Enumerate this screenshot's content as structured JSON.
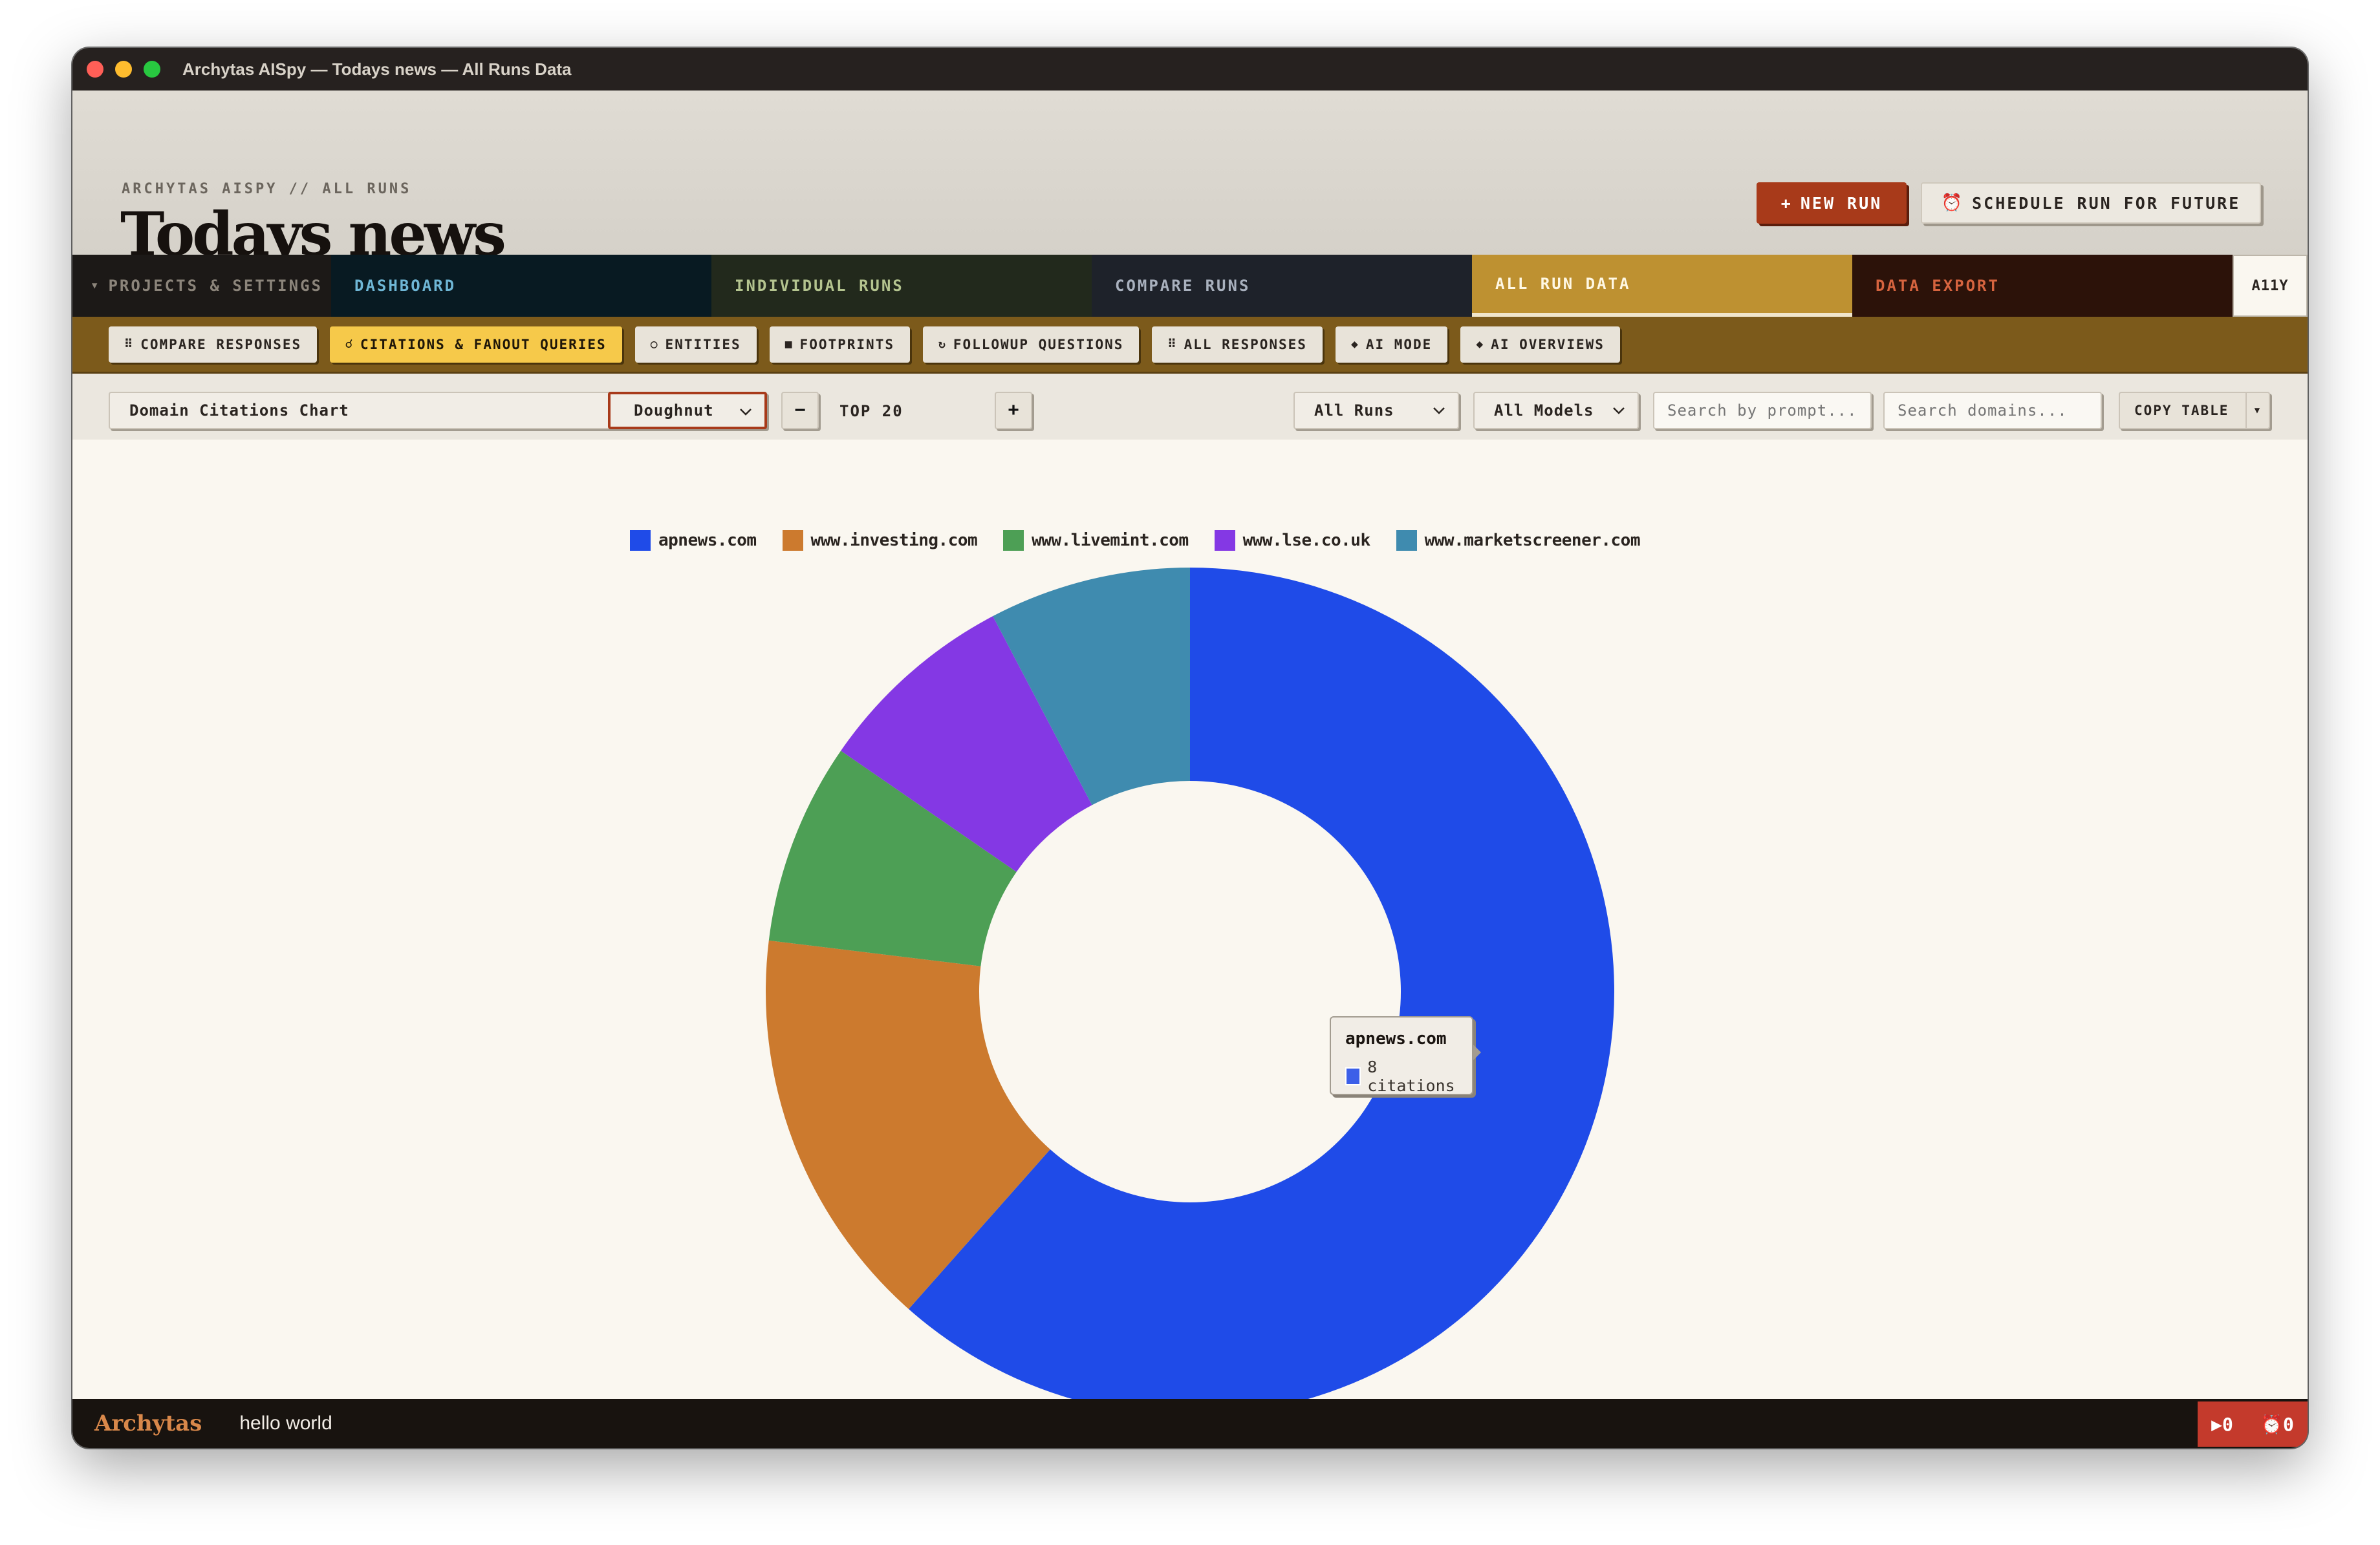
{
  "window": {
    "title": "Archytas AISpy — Todays news — All Runs Data"
  },
  "header": {
    "breadcrumb": "ARCHYTAS AISPY // ALL RUNS",
    "title": "Todays news",
    "new_run_label": "NEW RUN",
    "new_run_prefix": "+",
    "schedule_label": "SCHEDULE RUN FOR FUTURE"
  },
  "main_tabs": {
    "projects": "PROJECTS & SETTINGS",
    "dashboard": "DASHBOARD",
    "individual_runs": "INDIVIDUAL RUNS",
    "compare_runs": "COMPARE RUNS",
    "all_run_data": "ALL RUN DATA",
    "data_export": "DATA EXPORT",
    "a11y": "A11Y",
    "active": "all_run_data"
  },
  "sub_tabs": [
    {
      "label": "COMPARE RESPONSES",
      "icon": "grid-icon",
      "glyph": "⠿",
      "active": false
    },
    {
      "label": "CITATIONS & FANOUT QUERIES",
      "icon": "link-icon",
      "glyph": "☌",
      "active": true
    },
    {
      "label": "ENTITIES",
      "icon": "circle-icon",
      "glyph": "○",
      "active": false
    },
    {
      "label": "FOOTPRINTS",
      "icon": "square-icon",
      "glyph": "■",
      "active": false
    },
    {
      "label": "FOLLOWUP QUESTIONS",
      "icon": "refresh-icon",
      "glyph": "↻",
      "active": false
    },
    {
      "label": "ALL RESPONSES",
      "icon": "grid-icon",
      "glyph": "⠿",
      "active": false
    },
    {
      "label": "AI MODE",
      "icon": "diamond-icon",
      "glyph": "◆",
      "active": false
    },
    {
      "label": "AI OVERVIEWS",
      "icon": "diamond-icon",
      "glyph": "◆",
      "active": false
    }
  ],
  "toolbar": {
    "chart_select": "Domain Citations Chart",
    "chart_type": "Doughnut",
    "decrement": "−",
    "top_n": "TOP 20",
    "increment": "+",
    "runs_select": "All Runs",
    "models_select": "All Models",
    "prompt_placeholder": "Search by prompt...",
    "domain_placeholder": "Search domains...",
    "copy_label": "COPY TABLE"
  },
  "chart_data": {
    "type": "pie",
    "variant": "doughnut",
    "categories": [
      "apnews.com",
      "www.investing.com",
      "www.livemint.com",
      "www.lse.co.uk",
      "www.marketscreener.com"
    ],
    "values": [
      8,
      2,
      1,
      1,
      1
    ],
    "colors": [
      "#1f4be8",
      "#cc7a2e",
      "#4d9f55",
      "#8438e4",
      "#3f8baf"
    ],
    "legend_position": "top",
    "tooltip": {
      "label": "apnews.com",
      "value_text": "8 citations"
    }
  },
  "status_bar": {
    "brand": "Archytas",
    "message": "hello world",
    "running_count": "▶0",
    "queued_count": "⏰0"
  }
}
